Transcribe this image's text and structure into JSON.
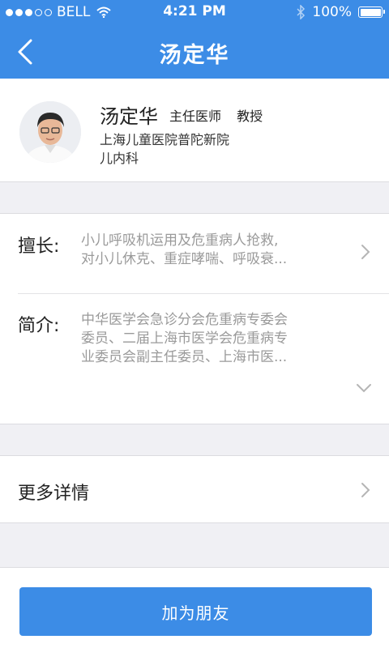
{
  "status_bar": {
    "carrier": "BELL",
    "time": "4:21 PM",
    "battery": "100%"
  },
  "header": {
    "title": "汤定华"
  },
  "profile": {
    "name": "汤定华",
    "title": "主任医师",
    "rank": "教授",
    "hospital": "上海儿童医院普陀新院",
    "department": "儿内科"
  },
  "specialty": {
    "label": "擅长:",
    "lines": [
      "小儿呼吸机运用及危重病人抢救,",
      "对小儿休克、重症哮喘、呼吸衰..."
    ]
  },
  "intro": {
    "label": "简介:",
    "lines": [
      "中华医学会急诊分会危重病专委会",
      "委员、二届上海市医学会危重病专",
      "业委员会副主任委员、上海市医..."
    ]
  },
  "more": {
    "label": "更多详情"
  },
  "action": {
    "add_friend": "加为朋友"
  },
  "colors": {
    "accent": "#3c8ce6",
    "background": "#f0f0f4"
  }
}
